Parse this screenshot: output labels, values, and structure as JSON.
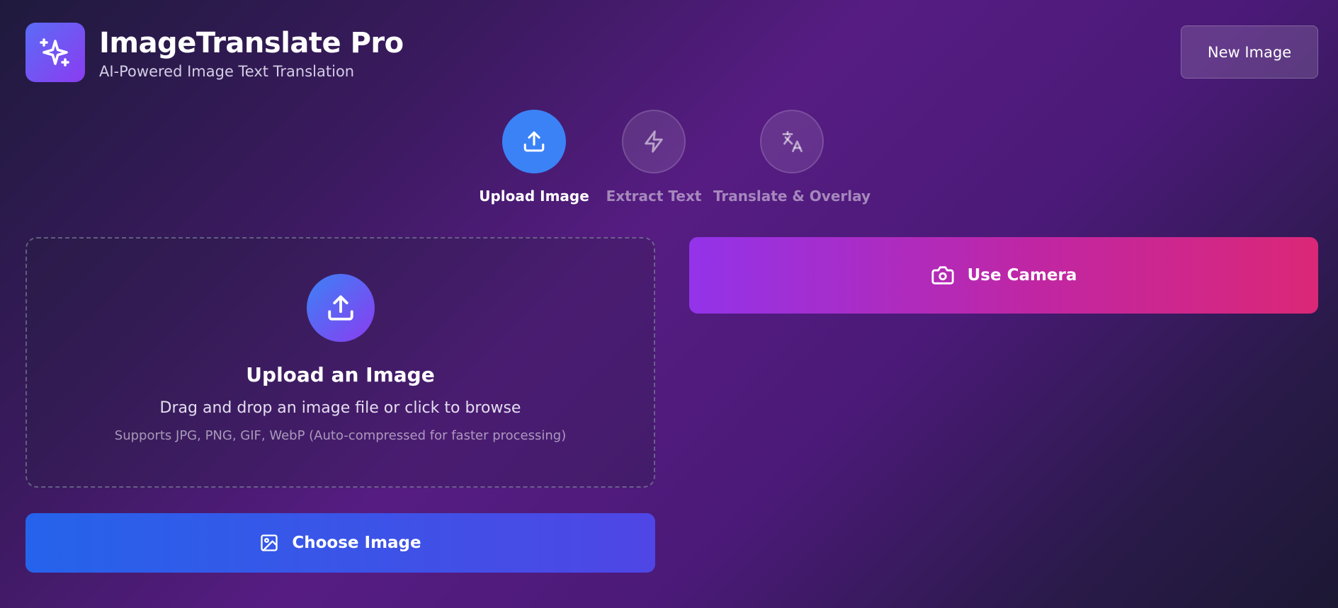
{
  "app": {
    "title": "ImageTranslate Pro",
    "subtitle": "AI-Powered Image Text Translation",
    "logo_icon": "sparkles-icon"
  },
  "header": {
    "new_image_label": "New Image"
  },
  "steps": [
    {
      "label": "Upload Image",
      "icon": "upload-icon",
      "active": true
    },
    {
      "label": "Extract Text",
      "icon": "lightning-icon",
      "active": false
    },
    {
      "label": "Translate & Overlay",
      "icon": "translate-icon",
      "active": false
    }
  ],
  "dropzone": {
    "icon": "upload-icon",
    "title": "Upload an Image",
    "description": "Drag and drop an image file or click to browse",
    "note": "Supports JPG, PNG, GIF, WebP (Auto-compressed for faster processing)"
  },
  "choose_button": {
    "label": "Choose Image",
    "icon": "image-icon"
  },
  "camera_button": {
    "label": "Use Camera",
    "icon": "camera-icon"
  },
  "colors": {
    "accent_blue": "#3b82f6",
    "choose_gradient_start": "#2563eb",
    "choose_gradient_end": "#4f46e5",
    "camera_gradient_start": "#9333ea",
    "camera_gradient_end": "#db2777",
    "logo_gradient_start": "#5b6cf6",
    "logo_gradient_end": "#8b3cf0"
  }
}
